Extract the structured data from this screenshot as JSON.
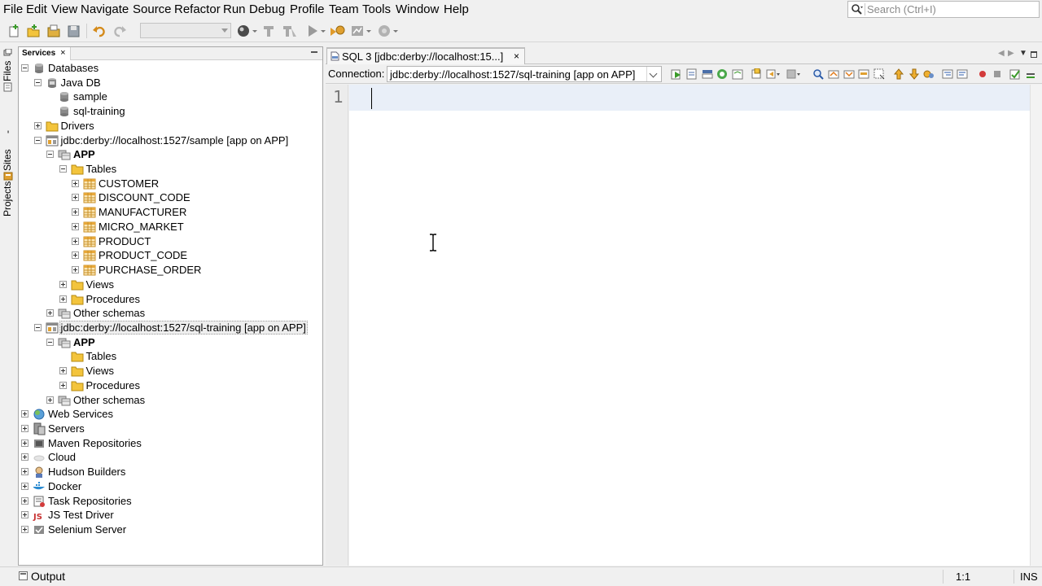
{
  "menu": [
    "File",
    "Edit",
    "View",
    "Navigate",
    "Source",
    "Refactor",
    "Run",
    "Debug",
    "Profile",
    "Team",
    "Tools",
    "Window",
    "Help"
  ],
  "search": {
    "placeholder": "Search (Ctrl+I)"
  },
  "left_strip": {
    "projects_label": "Projects",
    "files_label": "Files",
    "sites_label": "Sites"
  },
  "services": {
    "tab_label": "Services",
    "tab_close": "×",
    "tree": [
      {
        "label": "Databases",
        "icon": "database-icon",
        "toggle": "minus",
        "bold": false,
        "selected": false
      },
      {
        "label": "Java DB",
        "icon": "javadb-icon",
        "toggle": "minus",
        "bold": false,
        "selected": false
      },
      {
        "label": "sample",
        "icon": "database-icon",
        "toggle": "none",
        "bold": false,
        "selected": false
      },
      {
        "label": "sql-training",
        "icon": "database-icon",
        "toggle": "none",
        "bold": false,
        "selected": false
      },
      {
        "label": "Drivers",
        "icon": "folder-icon",
        "toggle": "plus",
        "bold": false,
        "selected": false
      },
      {
        "label": "jdbc:derby://localhost:1527/sample [app on APP]",
        "icon": "connection-icon",
        "toggle": "minus",
        "bold": false,
        "selected": false
      },
      {
        "label": "APP",
        "icon": "schema-icon",
        "toggle": "minus",
        "bold": true,
        "selected": false
      },
      {
        "label": "Tables",
        "icon": "folder-icon",
        "toggle": "minus",
        "bold": false,
        "selected": false
      },
      {
        "label": "CUSTOMER",
        "icon": "table-icon",
        "toggle": "plus",
        "bold": false,
        "selected": false
      },
      {
        "label": "DISCOUNT_CODE",
        "icon": "table-icon",
        "toggle": "plus",
        "bold": false,
        "selected": false
      },
      {
        "label": "MANUFACTURER",
        "icon": "table-icon",
        "toggle": "plus",
        "bold": false,
        "selected": false
      },
      {
        "label": "MICRO_MARKET",
        "icon": "table-icon",
        "toggle": "plus",
        "bold": false,
        "selected": false
      },
      {
        "label": "PRODUCT",
        "icon": "table-icon",
        "toggle": "plus",
        "bold": false,
        "selected": false
      },
      {
        "label": "PRODUCT_CODE",
        "icon": "table-icon",
        "toggle": "plus",
        "bold": false,
        "selected": false
      },
      {
        "label": "PURCHASE_ORDER",
        "icon": "table-icon",
        "toggle": "plus",
        "bold": false,
        "selected": false
      },
      {
        "label": "Views",
        "icon": "folder-icon",
        "toggle": "plus",
        "bold": false,
        "selected": false
      },
      {
        "label": "Procedures",
        "icon": "folder-icon",
        "toggle": "plus",
        "bold": false,
        "selected": false
      },
      {
        "label": "Other schemas",
        "icon": "schemas-icon",
        "toggle": "plus",
        "bold": false,
        "selected": false
      },
      {
        "label": "jdbc:derby://localhost:1527/sql-training [app on APP]",
        "icon": "connection-icon",
        "toggle": "minus",
        "bold": false,
        "selected": true
      },
      {
        "label": "APP",
        "icon": "schema-icon",
        "toggle": "minus",
        "bold": true,
        "selected": false
      },
      {
        "label": "Tables",
        "icon": "folder-icon",
        "toggle": "none",
        "bold": false,
        "selected": false
      },
      {
        "label": "Views",
        "icon": "folder-icon",
        "toggle": "plus",
        "bold": false,
        "selected": false
      },
      {
        "label": "Procedures",
        "icon": "folder-icon",
        "toggle": "plus",
        "bold": false,
        "selected": false
      },
      {
        "label": "Other schemas",
        "icon": "schemas-icon",
        "toggle": "plus",
        "bold": false,
        "selected": false
      },
      {
        "label": "Web Services",
        "icon": "web-services-icon",
        "toggle": "plus",
        "bold": false,
        "selected": false
      },
      {
        "label": "Servers",
        "icon": "servers-icon",
        "toggle": "plus",
        "bold": false,
        "selected": false
      },
      {
        "label": "Maven Repositories",
        "icon": "maven-icon",
        "toggle": "plus",
        "bold": false,
        "selected": false
      },
      {
        "label": "Cloud",
        "icon": "cloud-icon",
        "toggle": "plus",
        "bold": false,
        "selected": false
      },
      {
        "label": "Hudson Builders",
        "icon": "hudson-icon",
        "toggle": "plus",
        "bold": false,
        "selected": false
      },
      {
        "label": "Docker",
        "icon": "docker-icon",
        "toggle": "plus",
        "bold": false,
        "selected": false
      },
      {
        "label": "Task Repositories",
        "icon": "task-repo-icon",
        "toggle": "plus",
        "bold": false,
        "selected": false
      },
      {
        "label": "JS Test Driver",
        "icon": "js-icon",
        "toggle": "plus",
        "bold": false,
        "selected": false
      },
      {
        "label": "Selenium Server",
        "icon": "selenium-icon",
        "toggle": "plus",
        "bold": false,
        "selected": false
      }
    ]
  },
  "editor": {
    "tab_label": "SQL 3 [jdbc:derby://localhost:15...]",
    "tab_close": "×",
    "connection_label": "Connection:",
    "connection_value": "jdbc:derby://localhost:1527/sql-training [app on APP]",
    "line_numbers": [
      "1"
    ],
    "content": ""
  },
  "statusbar": {
    "output_label": "Output",
    "position": "1:1",
    "mode": "INS"
  },
  "colors": {
    "folder": "#f3c43c",
    "table": "#e0a030",
    "run_green": "#3a9a2a",
    "stop_red": "#d33b3b",
    "current_line": "#e9eff8"
  }
}
